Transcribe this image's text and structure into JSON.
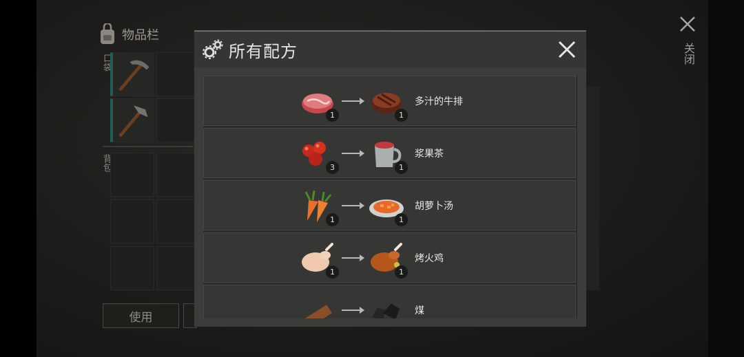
{
  "inventory": {
    "title": "物品栏",
    "pocket_label": "口袋",
    "backpack_label": "背包",
    "use_button": "使用"
  },
  "outer_close_label": "关闭",
  "modal": {
    "title": "所有配方"
  },
  "recipes": [
    {
      "input_icon": "raw-steak-icon",
      "input_count": "1",
      "output_icon": "grilled-steak-icon",
      "output_count": "1",
      "name": "多汁的牛排"
    },
    {
      "input_icon": "berries-icon",
      "input_count": "3",
      "output_icon": "tea-mug-icon",
      "output_count": "1",
      "name": "浆果茶"
    },
    {
      "input_icon": "carrot-icon",
      "input_count": "1",
      "output_icon": "carrot-soup-icon",
      "output_count": "1",
      "name": "胡萝卜汤"
    },
    {
      "input_icon": "raw-chicken-icon",
      "input_count": "1",
      "output_icon": "roast-chicken-icon",
      "output_count": "1",
      "name": "烤火鸡"
    },
    {
      "input_icon": "log-icon",
      "input_count": "",
      "output_icon": "coal-icon",
      "output_count": "",
      "name": "煤"
    }
  ],
  "colors": {
    "modal_bg": "#3c3d3a",
    "row_bg": "#363734",
    "slot_accent": "#1f5f58"
  }
}
